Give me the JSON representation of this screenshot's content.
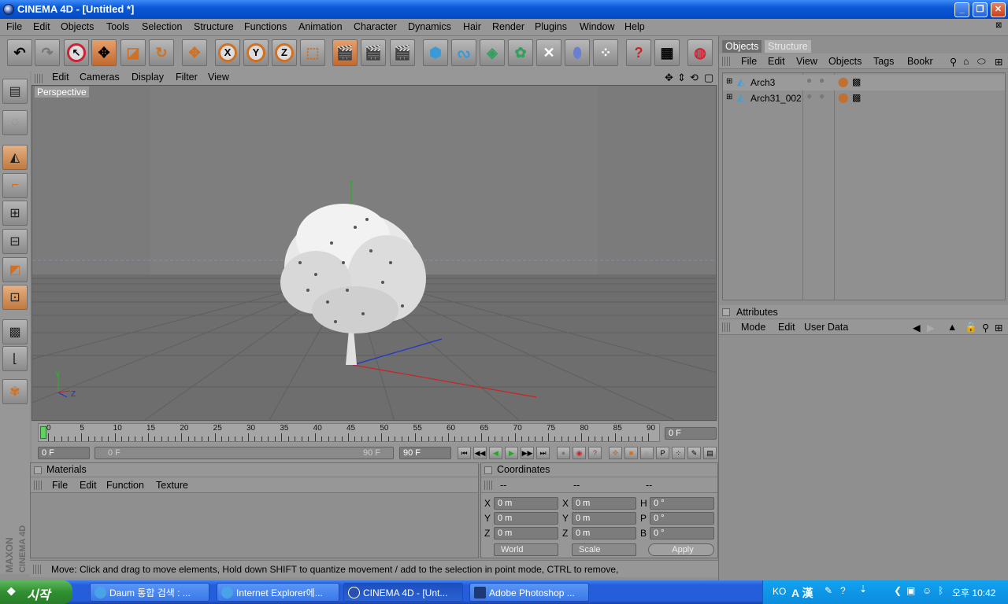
{
  "window": {
    "title": "CINEMA 4D - [Untitled *]",
    "buttons": [
      "_",
      "❐",
      "✕"
    ]
  },
  "menubar": [
    "File",
    "Edit",
    "Objects",
    "Tools",
    "Selection",
    "Structure",
    "Functions",
    "Animation",
    "Character",
    "Dynamics",
    "Hair",
    "Render",
    "Plugins",
    "Window",
    "Help"
  ],
  "viewport": {
    "menu": [
      "Edit",
      "Cameras",
      "Display",
      "Filter",
      "View"
    ],
    "label": "Perspective",
    "axis_labels": {
      "y": "Y",
      "x": "x",
      "z": "Z"
    }
  },
  "timeline": {
    "ticks": [
      "0",
      "5",
      "10",
      "15",
      "20",
      "25",
      "30",
      "35",
      "40",
      "45",
      "50",
      "55",
      "60",
      "65",
      "70",
      "75",
      "80",
      "85",
      "90"
    ],
    "current_frame": "0 F",
    "start_field": "0 F",
    "range_start": "0 F",
    "range_end": "90 F",
    "end_field": "90 F"
  },
  "materials": {
    "title": "Materials",
    "menu": [
      "File",
      "Edit",
      "Function",
      "Texture"
    ]
  },
  "coordinates": {
    "title": "Coordinates",
    "header_dashes": [
      "--",
      "--",
      "--"
    ],
    "rows": [
      {
        "a": "X",
        "av": "0 m",
        "b": "X",
        "bv": "0 m",
        "c": "H",
        "cv": "0 °"
      },
      {
        "a": "Y",
        "av": "0 m",
        "b": "Y",
        "bv": "0 m",
        "c": "P",
        "cv": "0 °"
      },
      {
        "a": "Z",
        "av": "0 m",
        "b": "Z",
        "bv": "0 m",
        "c": "B",
        "cv": "0 °"
      }
    ],
    "space_select": "World",
    "mode_select": "Scale",
    "apply_label": "Apply"
  },
  "status": "Move: Click and drag to move elements, Hold down SHIFT to quantize movement / add to the selection in point mode, CTRL to remove,",
  "objects_panel": {
    "tabs": [
      "Objects",
      "Structure"
    ],
    "menu": [
      "File",
      "Edit",
      "View",
      "Objects",
      "Tags",
      "Bookr"
    ],
    "items": [
      "Arch3",
      "Arch31_002"
    ]
  },
  "attributes_panel": {
    "title": "Attributes",
    "menu": [
      "Mode",
      "Edit",
      "User Data"
    ]
  },
  "maxon_logo": "MAXON CINEMA 4D",
  "taskbar": {
    "start": "시작",
    "tasks": [
      "Daum 통합 검색 : ...",
      "Internet Explorer에...",
      "CINEMA 4D - [Unt...",
      "Adobe Photoshop ..."
    ],
    "tray_lang": "KO",
    "tray_ime": "A 漢",
    "clock": "오후 10:42"
  }
}
